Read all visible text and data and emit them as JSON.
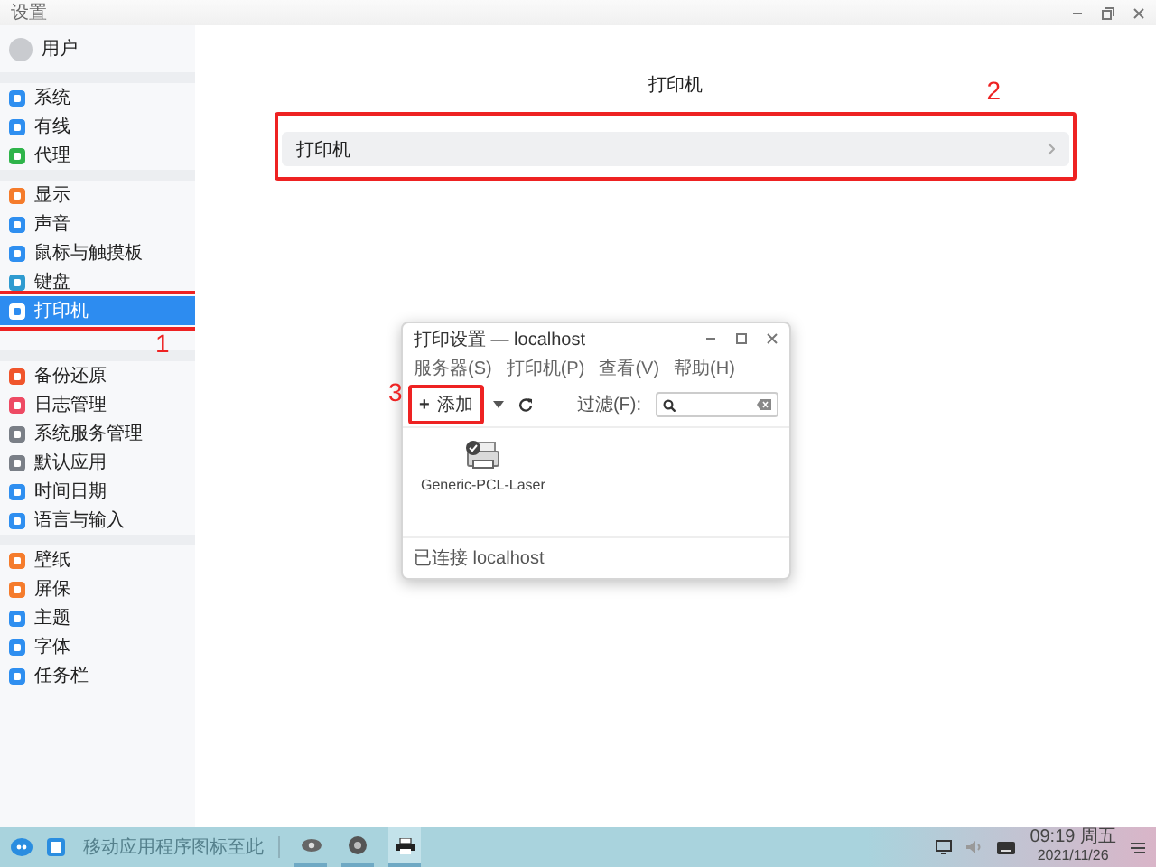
{
  "window": {
    "title": "设置"
  },
  "sidebar": {
    "user": {
      "name": "用户"
    },
    "groups": [
      {
        "items": [
          {
            "label": "系统",
            "color": "#2f8ff0",
            "selected": false
          },
          {
            "label": "有线",
            "color": "#2f8ff0",
            "selected": false
          },
          {
            "label": "代理",
            "color": "#2fb44a",
            "selected": false
          }
        ]
      },
      {
        "items": [
          {
            "label": "显示",
            "color": "#f57c2c",
            "selected": false
          },
          {
            "label": "声音",
            "color": "#2f8ff0",
            "selected": false
          },
          {
            "label": "鼠标与触摸板",
            "color": "#2f8ff0",
            "selected": false
          },
          {
            "label": "键盘",
            "color": "#2f9bd0",
            "selected": false
          },
          {
            "label": "打印机",
            "color": "#ffffff",
            "selected": true,
            "annotation": "1"
          }
        ]
      },
      {
        "items": [
          {
            "label": "备份还原",
            "color": "#f0552c",
            "selected": false
          },
          {
            "label": "日志管理",
            "color": "#ee4a64",
            "selected": false
          },
          {
            "label": "系统服务管理",
            "color": "#7a7f87",
            "selected": false
          },
          {
            "label": "默认应用",
            "color": "#7a7f87",
            "selected": false
          },
          {
            "label": "时间日期",
            "color": "#2f8ff0",
            "selected": false
          },
          {
            "label": "语言与输入",
            "color": "#2f8ff0",
            "selected": false
          }
        ]
      },
      {
        "items": [
          {
            "label": "壁纸",
            "color": "#f57c2c",
            "selected": false
          },
          {
            "label": "屏保",
            "color": "#f57c2c",
            "selected": false
          },
          {
            "label": "主题",
            "color": "#2f8ff0",
            "selected": false
          },
          {
            "label": "字体",
            "color": "#2f8ff0",
            "selected": false
          },
          {
            "label": "任务栏",
            "color": "#2f8ff0",
            "selected": false
          }
        ]
      }
    ]
  },
  "page": {
    "title": "打印机",
    "rows": [
      {
        "label": "打印机",
        "annotation": "2"
      }
    ]
  },
  "dialog": {
    "title": "打印设置 — localhost",
    "menus": [
      "服务器(S)",
      "打印机(P)",
      "查看(V)",
      "帮助(H)"
    ],
    "toolbar": {
      "add_icon": "+",
      "add_label": "添加",
      "annotation": "3",
      "filter_label": "过滤(F):"
    },
    "printers": [
      {
        "name": "Generic-PCL-Laser"
      }
    ],
    "status": "已连接 localhost"
  },
  "taskbar": {
    "hint": "移动应用程序图标至此",
    "apps": [
      {
        "kind": "viewer",
        "selected": false
      },
      {
        "kind": "settings",
        "selected": false
      },
      {
        "kind": "printer",
        "selected": true
      }
    ],
    "time": "09:19",
    "weekday": "周五",
    "date": "2021/11/26"
  }
}
